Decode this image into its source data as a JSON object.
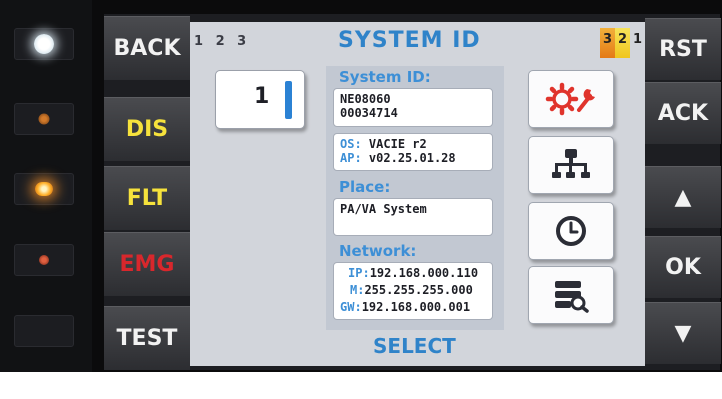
{
  "left_buttons": {
    "back": "BACK",
    "dis": "DIS",
    "flt": "FLT",
    "emg": "EMG",
    "test": "TEST"
  },
  "right_buttons": {
    "rst": "RST",
    "ack": "ACK",
    "up": "▲",
    "ok": "OK",
    "down": "▼"
  },
  "screen": {
    "page_numbers": "1 2 3",
    "title": "SYSTEM ID",
    "access_levels": [
      "3",
      "2",
      "1"
    ],
    "selector_value": "1",
    "system_id": {
      "label": "System ID:",
      "line1": "NE08060",
      "line2": "00034714"
    },
    "versions": {
      "os_key": "OS:",
      "os_value": "VACIE r2",
      "ap_key": "AP:",
      "ap_value": "v02.25.01.28"
    },
    "place": {
      "label": "Place:",
      "value": "PA/VA System"
    },
    "network": {
      "label": "Network:",
      "ip_key": "IP:",
      "ip_value": "192.168.000.110",
      "mask_key": "M:",
      "mask_value": "255.255.255.000",
      "gw_key": "GW:",
      "gw_value": "192.168.000.001"
    },
    "footer_action": "SELECT"
  },
  "colors": {
    "accent_blue": "#2f83c9",
    "label_blue": "#3d8fd6",
    "settings_icon_red": "#e0342c",
    "level3": "#e47a16",
    "level2": "#f0c61e"
  },
  "icons": [
    "settings-wrench-icon",
    "network-tree-icon",
    "clock-icon",
    "server-search-icon"
  ]
}
